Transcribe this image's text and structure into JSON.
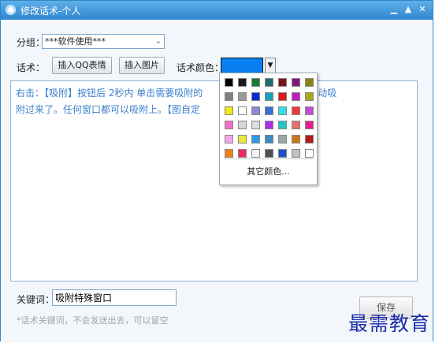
{
  "window": {
    "title": "修改话术-个人",
    "controls": [
      "minimize",
      "maximize",
      "close"
    ]
  },
  "form": {
    "group_label": "分组：",
    "group_value": "***软件使用***",
    "speech_label": "话术：",
    "insert_qq_button": "插入QQ表情",
    "insert_image_button": "插入图片",
    "speech_color_label": "话术颜色：",
    "selected_color": "#0a7ff2"
  },
  "editor": {
    "line1": "右击：【吸附】按钮后 2秒内 单击需要吸附的",
    "line1_end": "标，助手就会自动吸",
    "line2": "附过来了。任何窗口都可以吸附上。【图自定"
  },
  "palette": {
    "colors": [
      "#000000",
      "#1a1a1a",
      "#177a35",
      "#1f6e6a",
      "#7a1515",
      "#7d1878",
      "#8a8314",
      "#7f7f7f",
      "#9a9a9a",
      "#0a2bd8",
      "#1aa0b8",
      "#e01818",
      "#c218c0",
      "#a8a81a",
      "#f0e818",
      "#ffffff",
      "#8a8ad8",
      "#3a70d8",
      "#2ee0e8",
      "#f03838",
      "#c04cd8",
      "#f070c8",
      "#d8d8d8",
      "#dcdcdc",
      "#b030e8",
      "#20c8c8",
      "#e87070",
      "#f01890",
      "#f4a8e8",
      "#e8e838",
      "#2e9ae8",
      "#3a8ac0",
      "#9aa8a8",
      "#c87818",
      "#b81818",
      "#f08018",
      "#f02860",
      "#f8f0f8",
      "#505050",
      "#2050c8",
      "#c0c0c0",
      "#ffffff"
    ],
    "more_colors_label": "其它颜色..."
  },
  "keyword": {
    "label": "关键词：",
    "value": "吸附特殊窗口",
    "hint": "*话术关键词，不会发送出去，可以留空"
  },
  "save_button": "保存",
  "watermark": "最需教育"
}
